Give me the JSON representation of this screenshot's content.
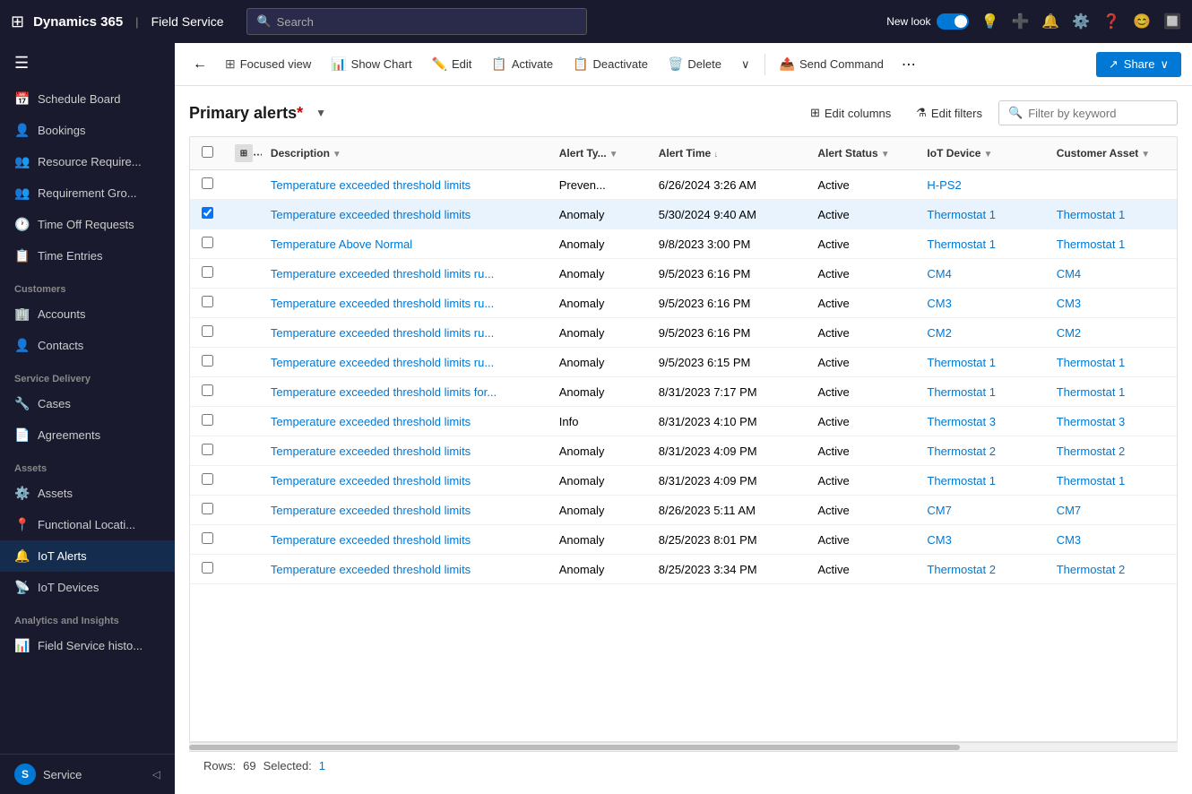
{
  "app": {
    "title": "Dynamics 365",
    "module": "Field Service",
    "search_placeholder": "Search"
  },
  "topnav": {
    "new_look_label": "New look",
    "share_label": "Share"
  },
  "sidebar": {
    "sections": [
      {
        "label": "",
        "items": [
          {
            "id": "schedule-board",
            "label": "Schedule Board",
            "icon": "📅"
          },
          {
            "id": "bookings",
            "label": "Bookings",
            "icon": "👤"
          },
          {
            "id": "resource-require",
            "label": "Resource Require...",
            "icon": "👥"
          },
          {
            "id": "requirement-gro",
            "label": "Requirement Gro...",
            "icon": "👥"
          },
          {
            "id": "time-off",
            "label": "Time Off Requests",
            "icon": "🕐"
          },
          {
            "id": "time-entries",
            "label": "Time Entries",
            "icon": "📋"
          }
        ]
      },
      {
        "label": "Customers",
        "items": [
          {
            "id": "accounts",
            "label": "Accounts",
            "icon": "🏢"
          },
          {
            "id": "contacts",
            "label": "Contacts",
            "icon": "👤"
          }
        ]
      },
      {
        "label": "Service Delivery",
        "items": [
          {
            "id": "cases",
            "label": "Cases",
            "icon": "🔧"
          },
          {
            "id": "agreements",
            "label": "Agreements",
            "icon": "📄"
          }
        ]
      },
      {
        "label": "Assets",
        "items": [
          {
            "id": "assets",
            "label": "Assets",
            "icon": "⚙️"
          },
          {
            "id": "functional-locati",
            "label": "Functional Locati...",
            "icon": "📍"
          },
          {
            "id": "iot-alerts",
            "label": "IoT Alerts",
            "icon": "🔔",
            "active": true
          },
          {
            "id": "iot-devices",
            "label": "IoT Devices",
            "icon": "📡"
          }
        ]
      },
      {
        "label": "Analytics and Insights",
        "items": [
          {
            "id": "field-service-histo",
            "label": "Field Service histo...",
            "icon": "📊"
          }
        ]
      }
    ]
  },
  "toolbar": {
    "back_title": "Back",
    "focused_view_label": "Focused view",
    "show_chart_label": "Show Chart",
    "edit_label": "Edit",
    "activate_label": "Activate",
    "deactivate_label": "Deactivate",
    "delete_label": "Delete",
    "more_label": "More",
    "send_command_label": "Send Command",
    "share_label": "Share"
  },
  "grid": {
    "title": "Primary alerts",
    "title_asterisk": "*",
    "edit_columns_label": "Edit columns",
    "edit_filters_label": "Edit filters",
    "filter_placeholder": "Filter by keyword",
    "columns": [
      {
        "id": "checkbox",
        "label": ""
      },
      {
        "id": "icon",
        "label": ""
      },
      {
        "id": "description",
        "label": "Description"
      },
      {
        "id": "alert_type",
        "label": "Alert Ty..."
      },
      {
        "id": "alert_time",
        "label": "Alert Time"
      },
      {
        "id": "alert_status",
        "label": "Alert Status"
      },
      {
        "id": "iot_device",
        "label": "IoT Device"
      },
      {
        "id": "customer_asset",
        "label": "Customer Asset"
      }
    ],
    "rows": [
      {
        "id": 1,
        "description": "Temperature exceeded threshold limits",
        "alert_type": "Preven...",
        "alert_time": "6/26/2024 3:26 AM",
        "alert_status": "Active",
        "iot_device": "H-PS2",
        "customer_asset": "",
        "selected": false,
        "device_link": true,
        "asset_link": false
      },
      {
        "id": 2,
        "description": "Temperature exceeded threshold limits",
        "alert_type": "Anomaly",
        "alert_time": "5/30/2024 9:40 AM",
        "alert_status": "Active",
        "iot_device": "Thermostat 1",
        "customer_asset": "Thermostat 1",
        "selected": true,
        "device_link": true,
        "asset_link": true
      },
      {
        "id": 3,
        "description": "Temperature Above Normal",
        "alert_type": "Anomaly",
        "alert_time": "9/8/2023 3:00 PM",
        "alert_status": "Active",
        "iot_device": "Thermostat 1",
        "customer_asset": "Thermostat 1",
        "selected": false,
        "device_link": true,
        "asset_link": true
      },
      {
        "id": 4,
        "description": "Temperature exceeded threshold limits ru...",
        "alert_type": "Anomaly",
        "alert_time": "9/5/2023 6:16 PM",
        "alert_status": "Active",
        "iot_device": "CM4",
        "customer_asset": "CM4",
        "selected": false,
        "device_link": true,
        "asset_link": true
      },
      {
        "id": 5,
        "description": "Temperature exceeded threshold limits ru...",
        "alert_type": "Anomaly",
        "alert_time": "9/5/2023 6:16 PM",
        "alert_status": "Active",
        "iot_device": "CM3",
        "customer_asset": "CM3",
        "selected": false,
        "device_link": true,
        "asset_link": true
      },
      {
        "id": 6,
        "description": "Temperature exceeded threshold limits ru...",
        "alert_type": "Anomaly",
        "alert_time": "9/5/2023 6:16 PM",
        "alert_status": "Active",
        "iot_device": "CM2",
        "customer_asset": "CM2",
        "selected": false,
        "device_link": true,
        "asset_link": true
      },
      {
        "id": 7,
        "description": "Temperature exceeded threshold limits ru...",
        "alert_type": "Anomaly",
        "alert_time": "9/5/2023 6:15 PM",
        "alert_status": "Active",
        "iot_device": "Thermostat 1",
        "customer_asset": "Thermostat 1",
        "selected": false,
        "device_link": true,
        "asset_link": true
      },
      {
        "id": 8,
        "description": "Temperature exceeded threshold limits for...",
        "alert_type": "Anomaly",
        "alert_time": "8/31/2023 7:17 PM",
        "alert_status": "Active",
        "iot_device": "Thermostat 1",
        "customer_asset": "Thermostat 1",
        "selected": false,
        "device_link": true,
        "asset_link": true
      },
      {
        "id": 9,
        "description": "Temperature exceeded threshold limits",
        "alert_type": "Info",
        "alert_time": "8/31/2023 4:10 PM",
        "alert_status": "Active",
        "iot_device": "Thermostat 3",
        "customer_asset": "Thermostat 3",
        "selected": false,
        "device_link": true,
        "asset_link": true
      },
      {
        "id": 10,
        "description": "Temperature exceeded threshold limits",
        "alert_type": "Anomaly",
        "alert_time": "8/31/2023 4:09 PM",
        "alert_status": "Active",
        "iot_device": "Thermostat 2",
        "customer_asset": "Thermostat 2",
        "selected": false,
        "device_link": true,
        "asset_link": true
      },
      {
        "id": 11,
        "description": "Temperature exceeded threshold limits",
        "alert_type": "Anomaly",
        "alert_time": "8/31/2023 4:09 PM",
        "alert_status": "Active",
        "iot_device": "Thermostat 1",
        "customer_asset": "Thermostat 1",
        "selected": false,
        "device_link": true,
        "asset_link": true
      },
      {
        "id": 12,
        "description": "Temperature exceeded threshold limits",
        "alert_type": "Anomaly",
        "alert_time": "8/26/2023 5:11 AM",
        "alert_status": "Active",
        "iot_device": "CM7",
        "customer_asset": "CM7",
        "selected": false,
        "device_link": true,
        "asset_link": true
      },
      {
        "id": 13,
        "description": "Temperature exceeded threshold limits",
        "alert_type": "Anomaly",
        "alert_time": "8/25/2023 8:01 PM",
        "alert_status": "Active",
        "iot_device": "CM3",
        "customer_asset": "CM3",
        "selected": false,
        "device_link": true,
        "asset_link": true
      },
      {
        "id": 14,
        "description": "Temperature exceeded threshold limits",
        "alert_type": "Anomaly",
        "alert_time": "8/25/2023 3:34 PM",
        "alert_status": "Active",
        "iot_device": "Thermostat 2",
        "customer_asset": "Thermostat 2",
        "selected": false,
        "device_link": true,
        "asset_link": true
      }
    ],
    "footer": {
      "rows_label": "Rows:",
      "rows_count": "69",
      "selected_label": "Selected:",
      "selected_count": "1"
    }
  }
}
